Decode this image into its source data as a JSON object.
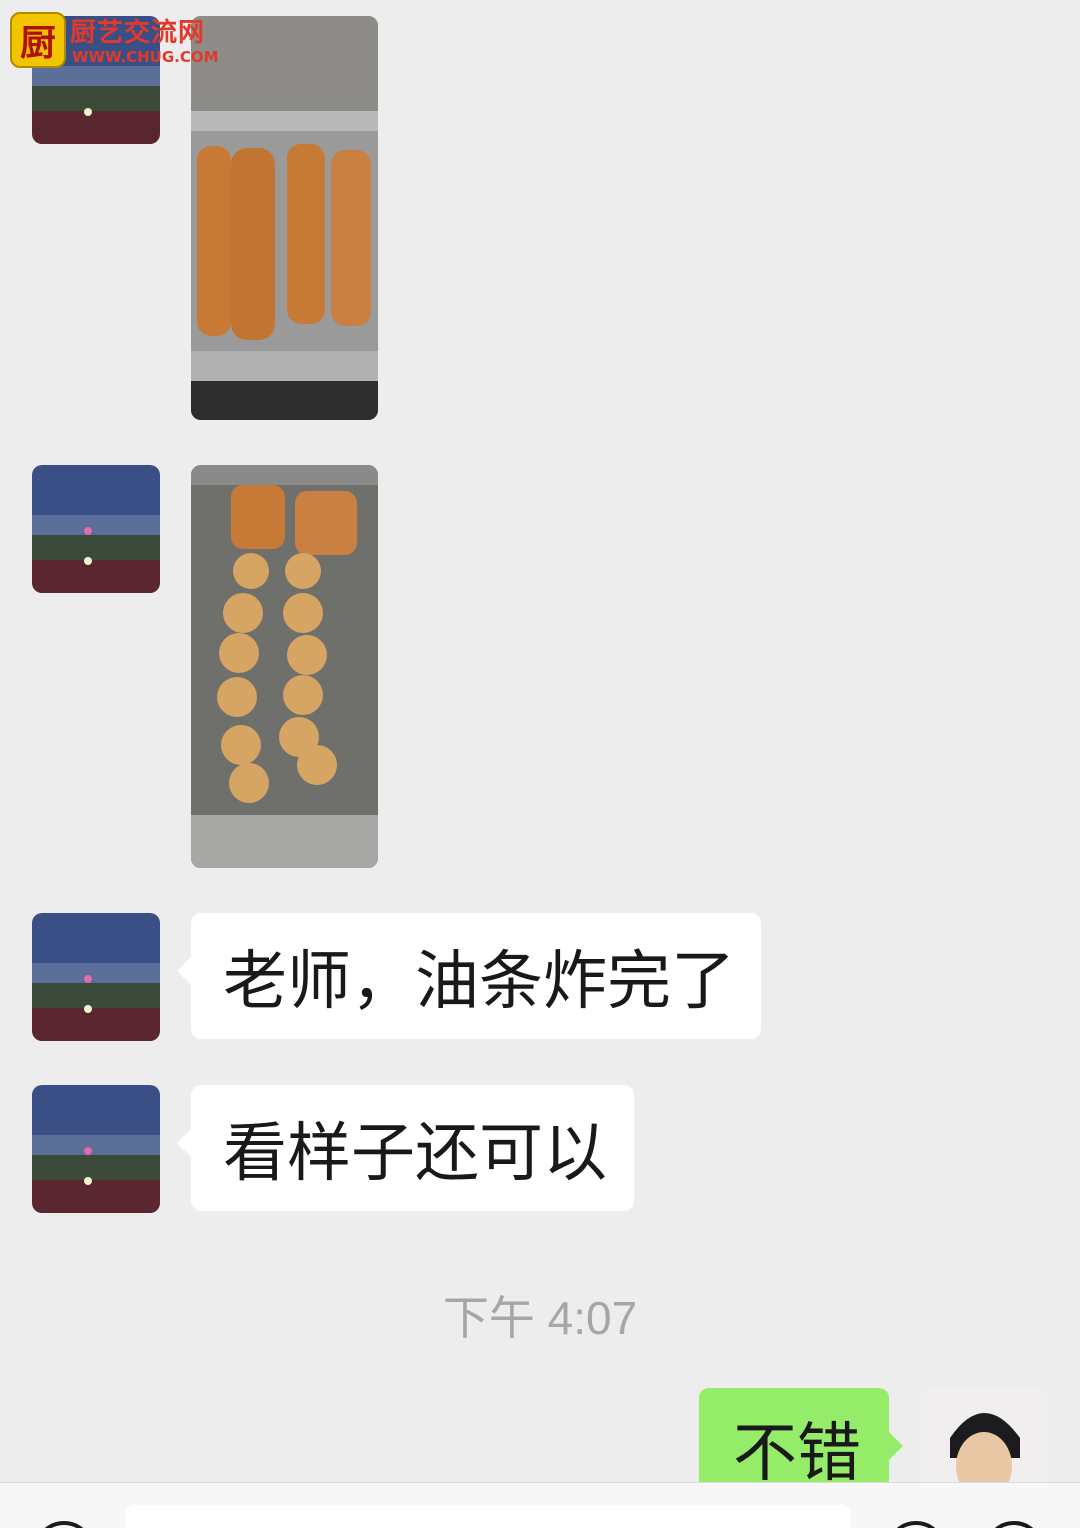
{
  "watermark": {
    "title": "厨艺交流网",
    "url": "WWW.CHUG.COM",
    "badge_char": "厨"
  },
  "messages": [
    {
      "side": "left",
      "kind": "image",
      "image_desc": "fried-dough-sticks-on-tray"
    },
    {
      "side": "left",
      "kind": "image",
      "image_desc": "fried-dough-cross-section-pieces"
    },
    {
      "side": "left",
      "kind": "text",
      "text": "老师，油条炸完了"
    },
    {
      "side": "left",
      "kind": "text",
      "text": "看样子还可以"
    },
    {
      "side": "right",
      "kind": "text",
      "text": "不错"
    }
  ],
  "timestamp": "下午 4:07",
  "colors": {
    "background": "#ededed",
    "bubble_incoming": "#ffffff",
    "bubble_outgoing": "#95ec69",
    "timestamp": "#a6a6a6"
  },
  "icons": {
    "voice": "voice-icon",
    "emoji": "emoji-icon",
    "plus": "plus-icon"
  }
}
